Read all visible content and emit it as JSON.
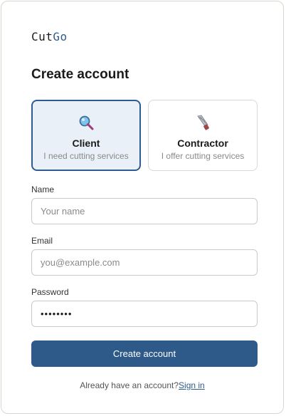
{
  "app": {
    "logo_part1": "Cut",
    "logo_part2": "Go",
    "brand_color": "#2e5c8f"
  },
  "form": {
    "title": "Create account",
    "roles": [
      {
        "name": "Client",
        "description": "I need cutting services",
        "icon": "magnifier-icon",
        "selected": true
      },
      {
        "name": "Contractor",
        "description": "I offer cutting services",
        "icon": "saw-icon",
        "selected": false
      }
    ],
    "name": {
      "label": "Name",
      "placeholder": "Your name",
      "value": ""
    },
    "email": {
      "label": "Email",
      "placeholder": "you@example.com",
      "value": ""
    },
    "password": {
      "label": "Password",
      "value": "••••••••"
    },
    "submit_label": "Create account"
  },
  "footer": {
    "prompt": "Already have an account?",
    "link_label": "Sign in"
  }
}
